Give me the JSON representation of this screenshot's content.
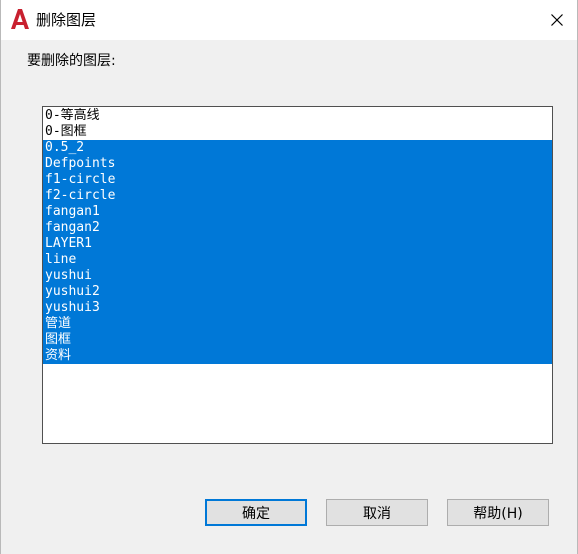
{
  "window": {
    "title": "删除图层",
    "app_icon": "autocad-icon",
    "close_icon": "close-icon"
  },
  "prompt": "要删除的图层:",
  "layers": [
    {
      "name": "0-等高线",
      "selected": false
    },
    {
      "name": "0-图框",
      "selected": false
    },
    {
      "name": "0.5_2",
      "selected": true
    },
    {
      "name": "Defpoints",
      "selected": true
    },
    {
      "name": "f1-circle",
      "selected": true
    },
    {
      "name": "f2-circle",
      "selected": true
    },
    {
      "name": "fangan1",
      "selected": true
    },
    {
      "name": "fangan2",
      "selected": true
    },
    {
      "name": "LAYER1",
      "selected": true
    },
    {
      "name": "line",
      "selected": true
    },
    {
      "name": "yushui",
      "selected": true
    },
    {
      "name": "yushui2",
      "selected": true
    },
    {
      "name": "yushui3",
      "selected": true
    },
    {
      "name": "管道",
      "selected": true
    },
    {
      "name": "图框",
      "selected": true
    },
    {
      "name": "资料",
      "selected": true
    }
  ],
  "buttons": {
    "ok": "确定",
    "cancel": "取消",
    "help": "帮助(H)"
  },
  "colors": {
    "selection": "#0078d7",
    "brand_red": "#c8202f",
    "dialog_bg": "#f0f0f0"
  }
}
